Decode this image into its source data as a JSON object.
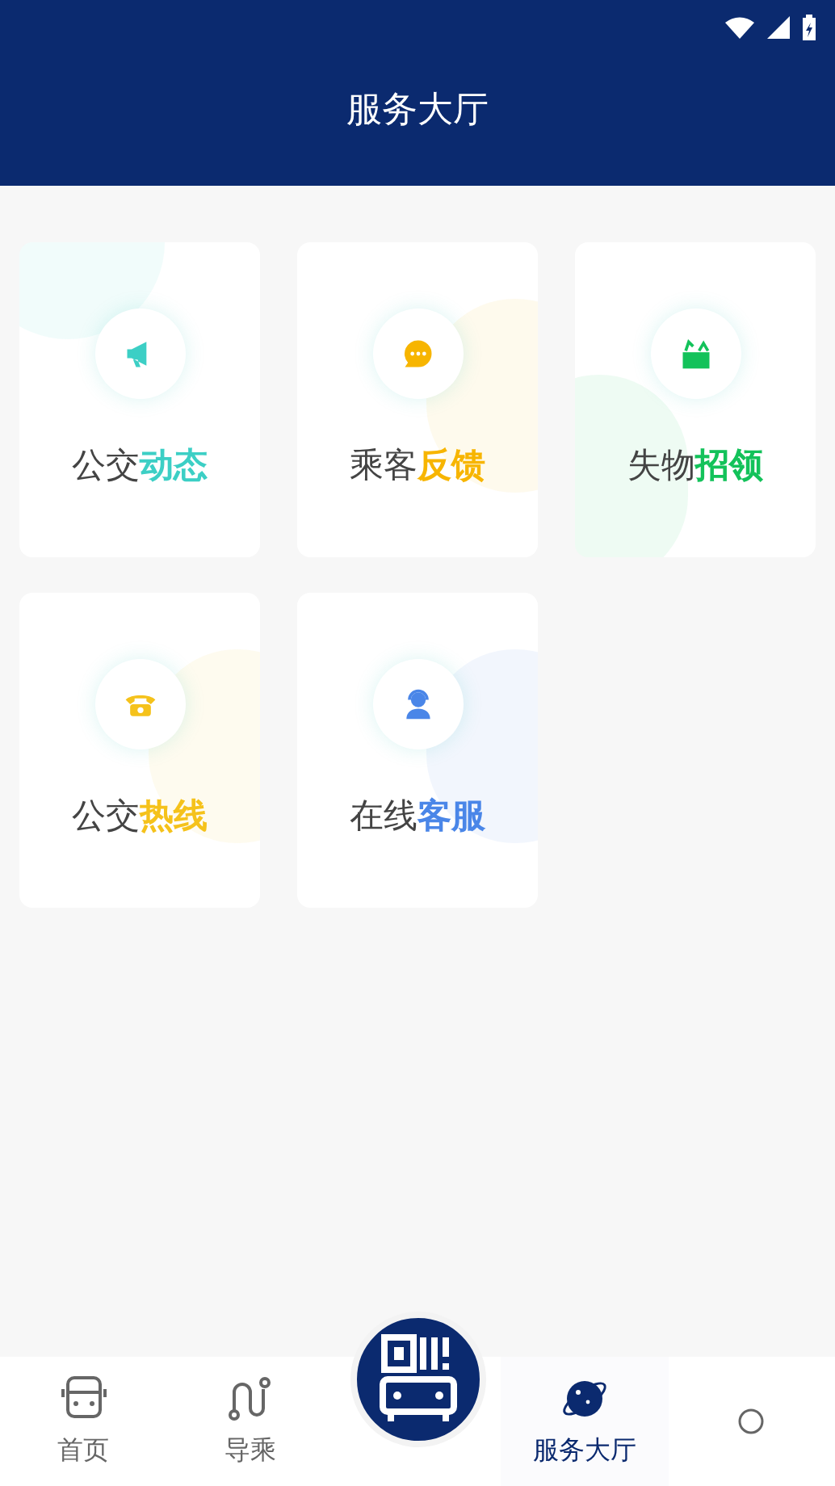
{
  "header": {
    "title": "服务大厅"
  },
  "services": [
    {
      "prefix": "公交",
      "highlight": "动态",
      "color": "#3ccfc5"
    },
    {
      "prefix": "乘客",
      "highlight": "反馈",
      "color": "#f7b500"
    },
    {
      "prefix": "失物",
      "highlight": "招领",
      "color": "#13c25a"
    },
    {
      "prefix": "公交",
      "highlight": "热线",
      "color": "#f5c21b"
    },
    {
      "prefix": "在线",
      "highlight": "客服",
      "color": "#4a86e8"
    }
  ],
  "tab_bar": {
    "tabs": [
      {
        "kind": "tab",
        "label": "首页",
        "selected": false
      },
      {
        "kind": "tab",
        "label": "导乘",
        "selected": false
      },
      {
        "kind": "center",
        "selected": false
      },
      {
        "kind": "tab",
        "label": "服务大厅",
        "selected": true
      },
      {
        "kind": "tab",
        "selected": false
      }
    ]
  }
}
